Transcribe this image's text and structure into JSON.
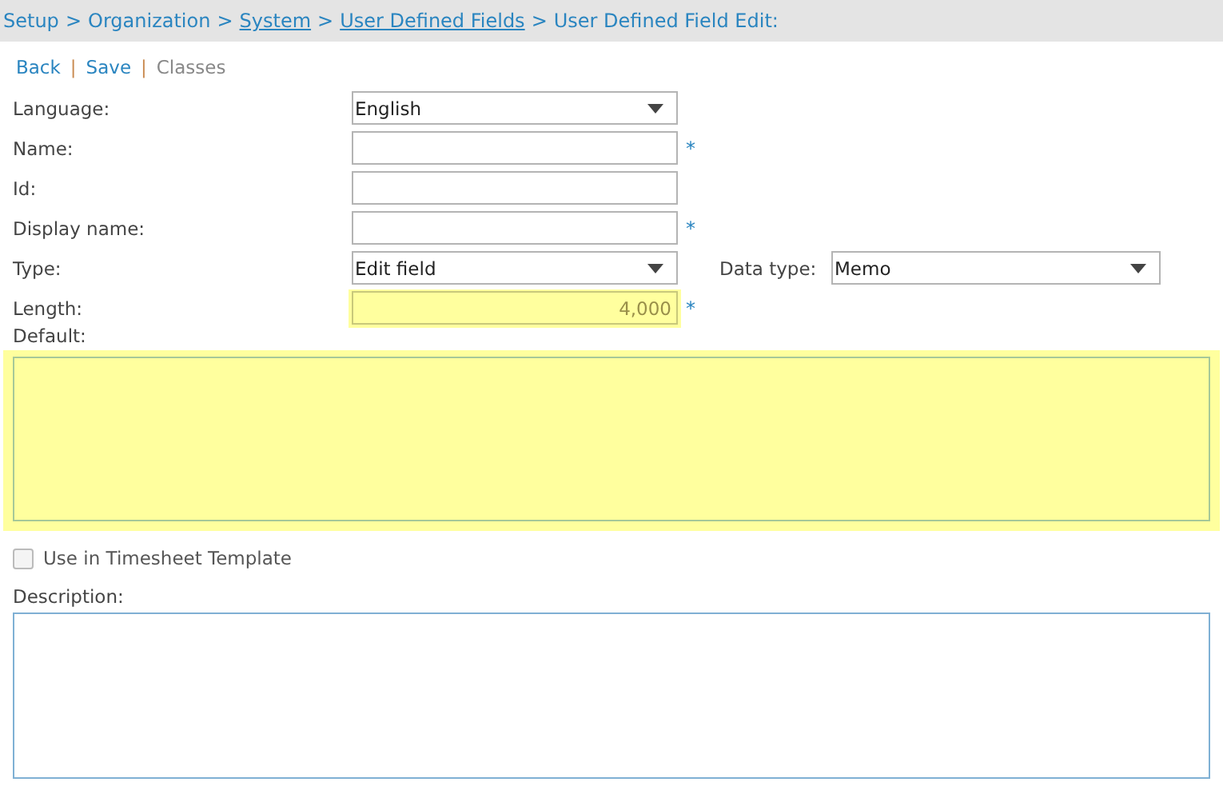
{
  "breadcrumb": [
    {
      "kind": "crumb",
      "text": "Setup"
    },
    {
      "kind": "separator",
      "text": ">"
    },
    {
      "kind": "crumb",
      "text": "Organization"
    },
    {
      "kind": "separator",
      "text": ">"
    },
    {
      "kind": "link",
      "text": "System"
    },
    {
      "kind": "separator",
      "text": ">"
    },
    {
      "kind": "link",
      "text": "User Defined Fields"
    },
    {
      "kind": "separator",
      "text": ">"
    },
    {
      "kind": "crumb",
      "text": "User Defined Field Edit:"
    }
  ],
  "actions": [
    {
      "kind": "link",
      "text": "Back",
      "disabled": false
    },
    {
      "kind": "separator",
      "text": "|"
    },
    {
      "kind": "link",
      "text": "Save",
      "disabled": false
    },
    {
      "kind": "separator",
      "text": "|"
    },
    {
      "kind": "link",
      "text": "Classes",
      "disabled": true
    }
  ],
  "fields": [
    {
      "label": "Language:",
      "kind": "select",
      "value": "English",
      "highlighted": false
    },
    {
      "label": "Name:",
      "kind": "text",
      "required_mark": "*",
      "highlighted": false
    },
    {
      "label": "Id:",
      "kind": "text",
      "highlighted": false
    },
    {
      "label": "Display name:",
      "kind": "text",
      "required_mark": "*",
      "highlighted": false
    },
    {
      "label": "Type:",
      "kind": "select",
      "value": "Edit field",
      "highlighted": false,
      "extra": {
        "label": "Data type:",
        "value": "Memo"
      }
    },
    {
      "label": "Length:",
      "kind": "number",
      "value": "4,000",
      "required_mark": "*",
      "highlighted": true
    }
  ],
  "default_field": {
    "label": "Default:",
    "highlighted": true
  },
  "timesheet_checkbox": {
    "label": "Use in Timesheet Template",
    "checked": false
  },
  "description": {
    "label": "Description:"
  }
}
